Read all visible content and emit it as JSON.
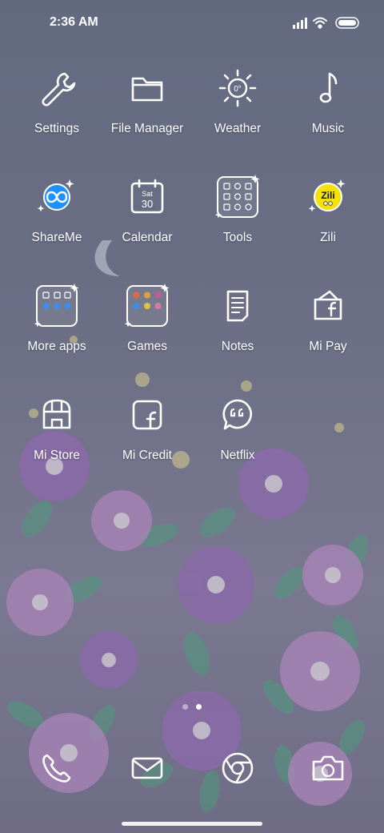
{
  "status": {
    "time": "2:36 AM"
  },
  "apps": [
    {
      "label": "Settings"
    },
    {
      "label": "File Manager"
    },
    {
      "label": "Weather",
      "temp": "0°"
    },
    {
      "label": "Music"
    },
    {
      "label": "ShareMe"
    },
    {
      "label": "Calendar",
      "day": "Sat",
      "date": "30"
    },
    {
      "label": "Tools"
    },
    {
      "label": "Zili",
      "badge": "Zili"
    },
    {
      "label": "More apps"
    },
    {
      "label": "Games"
    },
    {
      "label": "Notes"
    },
    {
      "label": "Mi Pay"
    },
    {
      "label": "Mi Store"
    },
    {
      "label": "Mi Credit"
    },
    {
      "label": "Netflix"
    }
  ],
  "dock": [
    {
      "icon": "phone-icon"
    },
    {
      "icon": "messages-icon"
    },
    {
      "icon": "browser-icon"
    },
    {
      "icon": "camera-icon"
    }
  ],
  "page_indicator": {
    "pages": 2,
    "current": 2
  },
  "colors": {
    "accent_shareme": "#1e90ff",
    "zili_yellow": "#f5e10a",
    "background": "#6a6e84"
  }
}
